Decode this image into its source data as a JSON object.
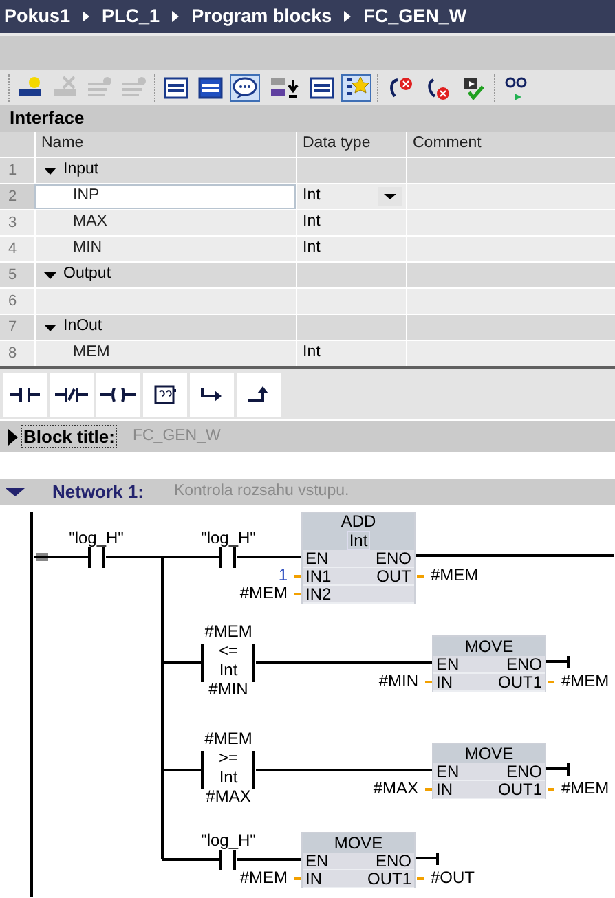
{
  "breadcrumb": [
    "Pokus1",
    "PLC_1",
    "Program blocks",
    "FC_GEN_W"
  ],
  "toolbar": [
    [
      {
        "kind": "insert_row",
        "disabled": false,
        "selected": false
      },
      {
        "kind": "delete_row",
        "disabled": true,
        "selected": false
      },
      {
        "kind": "insert_lines",
        "disabled": true,
        "selected": false
      },
      {
        "kind": "append_lines",
        "disabled": true,
        "selected": false
      }
    ],
    [
      {
        "kind": "panel_top",
        "disabled": false,
        "selected": false
      },
      {
        "kind": "panel_full",
        "disabled": false,
        "selected": false
      },
      {
        "kind": "comment",
        "disabled": false,
        "selected": true
      },
      {
        "kind": "tag_download",
        "disabled": false,
        "selected": false
      },
      {
        "kind": "list",
        "disabled": false,
        "selected": false
      },
      {
        "kind": "favorite",
        "disabled": false,
        "selected": true
      }
    ],
    [
      {
        "kind": "error_back",
        "disabled": false,
        "selected": false
      },
      {
        "kind": "error_next",
        "disabled": false,
        "selected": false
      },
      {
        "kind": "compile",
        "disabled": false,
        "selected": false
      }
    ],
    [
      {
        "kind": "monitor",
        "disabled": false,
        "selected": false
      }
    ]
  ],
  "interface": {
    "title": "Interface",
    "columns": [
      "Name",
      "Data type",
      "Comment"
    ],
    "sections": [
      {
        "number": "1",
        "name": "Input",
        "expanded": true,
        "children": [
          {
            "number": "2",
            "name": "INP",
            "type": "Int",
            "selected": true
          },
          {
            "number": "3",
            "name": "MAX",
            "type": "Int",
            "selected": false
          },
          {
            "number": "4",
            "name": "MIN",
            "type": "Int",
            "selected": false
          }
        ]
      },
      {
        "number": "5",
        "name": "Output",
        "expanded": true,
        "children": [
          {
            "number": "6",
            "selected": false
          }
        ]
      },
      {
        "number": "7",
        "name": "InOut",
        "expanded": true,
        "children": [
          {
            "number": "8",
            "name": "MEM",
            "type": "Int",
            "selected": false
          }
        ]
      }
    ]
  },
  "palette": [
    {
      "kind": "no_contact"
    },
    {
      "kind": "nc_contact"
    },
    {
      "kind": "coil"
    },
    {
      "kind": "empty_box"
    },
    {
      "kind": "open_branch"
    },
    {
      "kind": "close_branch"
    }
  ],
  "block_title": {
    "label": "Block title:",
    "value": "FC_GEN_W",
    "expanded": false
  },
  "network": {
    "title": "Network 1:",
    "comment": "Kontrola rozsahu vstupu.",
    "expanded": true,
    "main_contact": {
      "tag": "\"log_H\""
    },
    "branches": [
      {
        "condition": {
          "kind": "contact",
          "tag": "\"log_H\""
        },
        "block": {
          "name": "ADD",
          "type": "Int",
          "eno_terminated": false,
          "inputs": [
            {
              "pin": "EN"
            },
            {
              "pin": "IN1",
              "operand": "1",
              "constant": true
            },
            {
              "pin": "IN2",
              "operand": "#MEM",
              "constant": false
            }
          ],
          "outputs": [
            {
              "pin": "ENO"
            },
            {
              "pin": "OUT",
              "operand": "#MEM"
            }
          ]
        }
      },
      {
        "condition": {
          "kind": "compare",
          "operand1": "#MEM",
          "operator": "<=",
          "type": "Int",
          "operand2": "#MIN"
        },
        "block": {
          "name": "MOVE",
          "eno_terminated": true,
          "inputs": [
            {
              "pin": "EN"
            },
            {
              "pin": "IN",
              "operand": "#MIN",
              "constant": false
            }
          ],
          "outputs": [
            {
              "pin": "ENO"
            },
            {
              "pin": "OUT1",
              "operand": "#MEM"
            }
          ]
        }
      },
      {
        "condition": {
          "kind": "compare",
          "operand1": "#MEM",
          "operator": ">=",
          "type": "Int",
          "operand2": "#MAX"
        },
        "block": {
          "name": "MOVE",
          "eno_terminated": true,
          "inputs": [
            {
              "pin": "EN"
            },
            {
              "pin": "IN",
              "operand": "#MAX",
              "constant": false
            }
          ],
          "outputs": [
            {
              "pin": "ENO"
            },
            {
              "pin": "OUT1",
              "operand": "#MEM"
            }
          ]
        }
      },
      {
        "condition": {
          "kind": "contact",
          "tag": "\"log_H\""
        },
        "block": {
          "name": "MOVE",
          "eno_terminated": true,
          "inputs": [
            {
              "pin": "EN"
            },
            {
              "pin": "IN",
              "operand": "#MEM",
              "constant": false
            }
          ],
          "outputs": [
            {
              "pin": "ENO"
            },
            {
              "pin": "OUT1",
              "operand": "#OUT"
            }
          ]
        }
      }
    ]
  }
}
